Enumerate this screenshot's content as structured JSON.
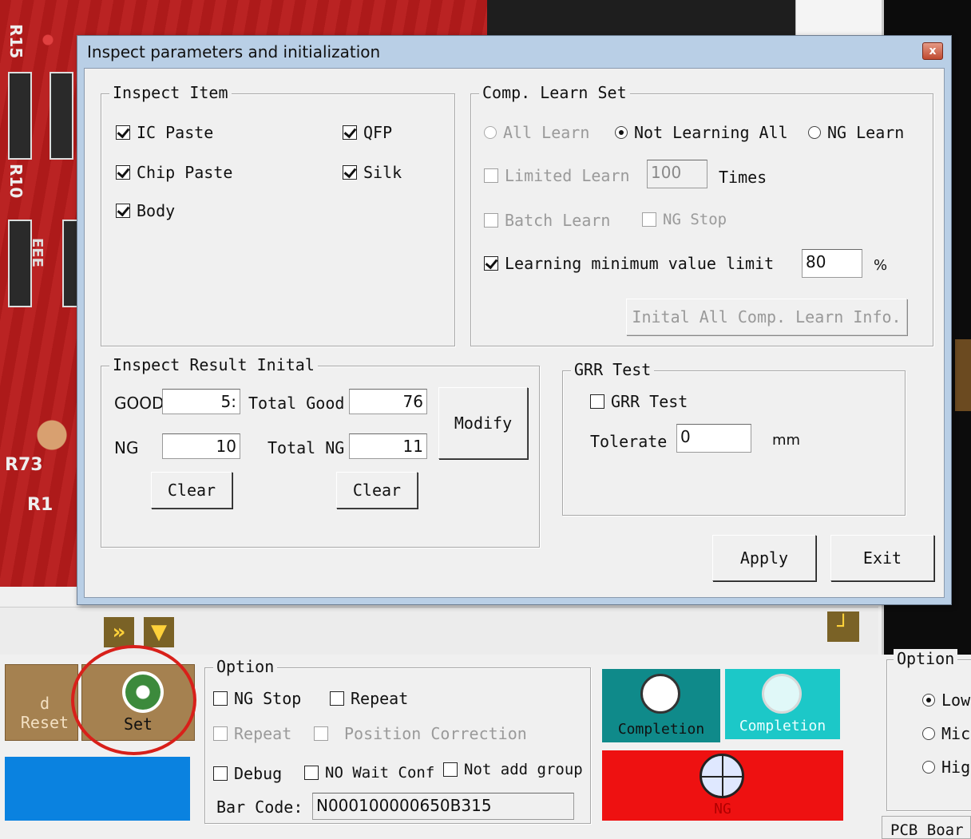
{
  "background": {
    "pcb_labels": [
      "R15",
      "R10",
      "R73",
      "R1"
    ],
    "pcb_chip_labels": [
      "EEE"
    ],
    "left_panel_button_label": "d Reset",
    "set_button_label": "Set",
    "option_group": {
      "title": "Option",
      "ng_stop": "NG Stop",
      "repeat": "Repeat",
      "repeat2": "Repeat",
      "position_correction": "Position Correction",
      "debug": "Debug",
      "no_wait_conf": "NO Wait Conf",
      "not_add_group": "Not add group",
      "bar_code_label": "Bar Code:",
      "bar_code_value": "N000100000650B315"
    },
    "completion_1": "Completion",
    "completion_2": "Completion",
    "ng_label": "NG",
    "right_option_group": {
      "title": "Option",
      "low": "Low",
      "mid": "Mic",
      "high": "Hig"
    },
    "pcb_board_label": "PCB Boar"
  },
  "dialog": {
    "title": "Inspect parameters and initialization",
    "close_label": "x",
    "inspect_item": {
      "title": "Inspect Item",
      "ic_paste": "IC Paste",
      "qfp": "QFP",
      "chip_paste": "Chip Paste",
      "silk": "Silk",
      "body": "Body"
    },
    "comp_learn_set": {
      "title": "Comp. Learn Set",
      "all_learn": "All Learn",
      "not_learning_all": "Not Learning All",
      "ng_learn": "NG Learn",
      "limited_learn": "Limited Learn",
      "limited_learn_value": "100",
      "times": "Times",
      "batch_learn": "Batch Learn",
      "ng_stop": "NG Stop",
      "learning_min_limit": "Learning minimum value limit",
      "learning_min_value": "80",
      "percent": "%",
      "init_button": "Inital All Comp. Learn Info."
    },
    "inspect_result": {
      "title": "Inspect Result Inital",
      "good_label": "GOOD",
      "good_value": "5:",
      "total_good_label": "Total Good",
      "total_good_value": "76",
      "ng_label": "NG",
      "ng_value": "10",
      "total_ng_label": "Total NG",
      "total_ng_value": "11",
      "modify_button": "Modify",
      "clear_button_1": "Clear",
      "clear_button_2": "Clear"
    },
    "grr_test": {
      "title": "GRR Test",
      "grr_checkbox": "GRR Test",
      "tolerate_label": "Tolerate",
      "tolerate_value": "0",
      "unit": "mm"
    },
    "apply_button": "Apply",
    "exit_button": "Exit"
  },
  "colors": {
    "pcb_red": "#b81c1c",
    "dialog_frame": "#b9cfe6",
    "completion_teal": "#0f8a8a",
    "completion_cyan": "#1cc8c8",
    "ng_red": "#ee1111",
    "blue_bar": "#0a82e0",
    "set_brown": "#a58150",
    "annotation_red": "#d8201a"
  }
}
